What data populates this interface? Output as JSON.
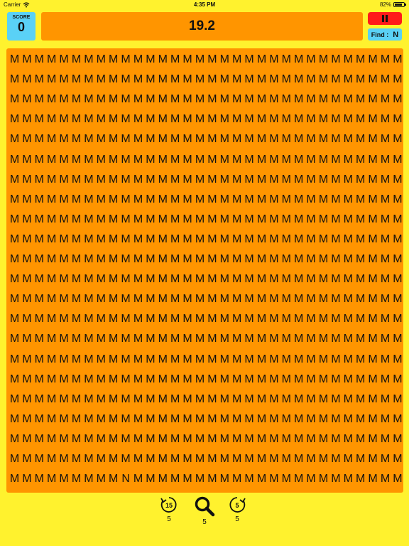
{
  "status_bar": {
    "carrier": "Carrier",
    "time": "4:35 PM",
    "battery": "82%",
    "battery_level": 0.82
  },
  "score": {
    "label": "SCORE",
    "value": "0"
  },
  "timer": {
    "value": "19.2"
  },
  "find": {
    "label": "Find :",
    "target": "N"
  },
  "grid": {
    "rows": 22,
    "cols": 32,
    "fill_letter": "M",
    "odd_letter": "N",
    "odd_row": 21,
    "odd_col": 9
  },
  "footer": {
    "rewind_badge": "15",
    "rewind_count": "5",
    "hint_count": "5",
    "forward_badge": "5",
    "forward_count": "5"
  },
  "colors": {
    "background": "#fff22e",
    "grid": "#ff9500",
    "accent_blue": "#5ad1f6",
    "pause_red": "#ff1a1a"
  }
}
